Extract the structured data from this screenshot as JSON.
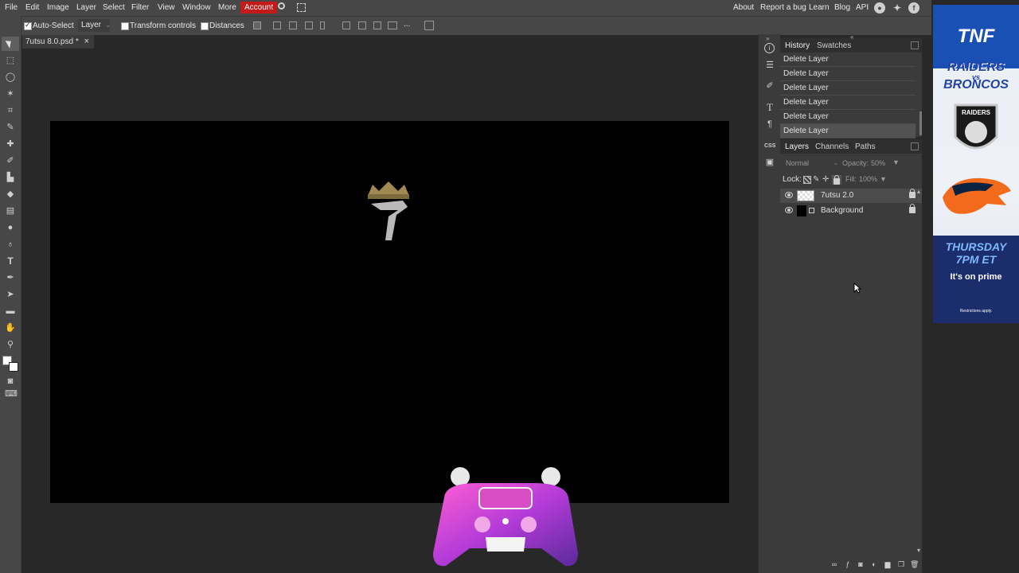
{
  "menu": {
    "items": [
      "File",
      "Edit",
      "Image",
      "Layer",
      "Select",
      "Filter",
      "View",
      "Window",
      "More"
    ],
    "account": "Account",
    "right_links": [
      "About",
      "Report a bug",
      "Learn",
      "Blog",
      "API"
    ],
    "social_icons": [
      "reddit-icon",
      "twitter-icon",
      "facebook-icon"
    ]
  },
  "options": {
    "auto_select_label": "Auto-Select",
    "auto_select_checked": true,
    "mode_value": "Layer",
    "transform_label": "Transform controls",
    "distances_label": "Distances",
    "more": "..."
  },
  "document": {
    "tab_name": "7utsu 8.0.psd *",
    "close": "×"
  },
  "history": {
    "tabs": [
      "History",
      "Swatches"
    ],
    "rows": [
      "Delete Layer",
      "Delete Layer",
      "Delete Layer",
      "Delete Layer",
      "Delete Layer",
      "Delete Layer"
    ]
  },
  "layers_panel": {
    "tabs": [
      "Layers",
      "Channels",
      "Paths"
    ],
    "blend_mode": "Normal",
    "opacity_label": "Opacity:",
    "opacity_value": "50%",
    "lock_label": "Lock:",
    "fill_label": "Fill:",
    "fill_value": "100%",
    "layers": [
      {
        "name": "7utsu 2.0",
        "selected": true
      },
      {
        "name": "Background",
        "selected": false
      }
    ]
  },
  "ad": {
    "brand": "TNF",
    "headline_line1": "RAIDERS",
    "headline_vs": "vs",
    "headline_line2": "BRONCOS",
    "team1_logo_text": "RAIDERS",
    "day": "THURSDAY",
    "time": "7PM ET",
    "tagline": "It's on prime",
    "disclaimer": "Restrictions apply."
  },
  "colors": {
    "menubar": "#474747",
    "account_accent": "#c41a1a",
    "canvas": "#000000",
    "panel": "#3b3b3b",
    "workspace": "#282828"
  }
}
